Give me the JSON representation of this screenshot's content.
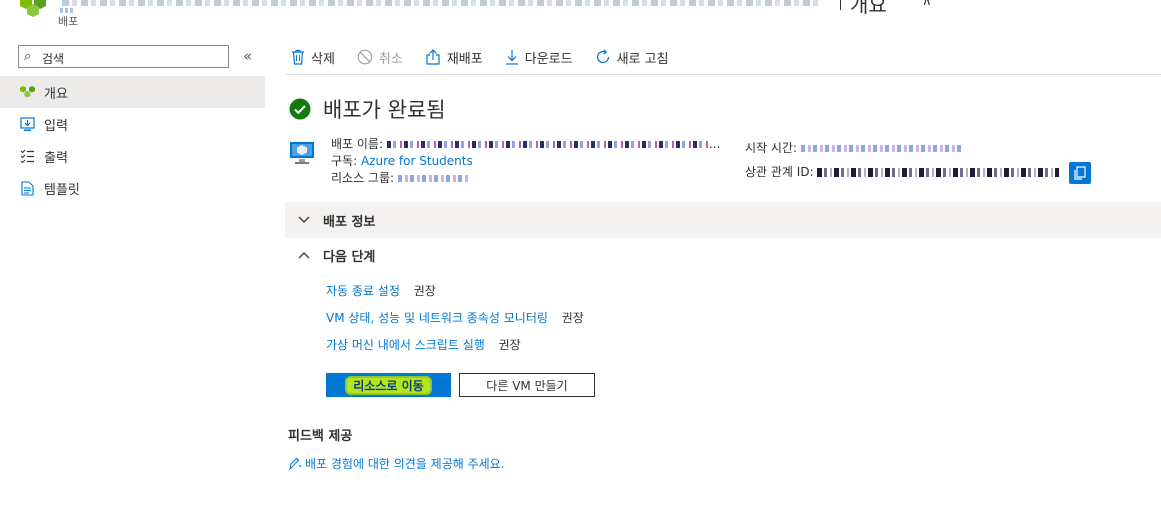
{
  "header": {
    "title_tail": "개요",
    "subtitle": "배포",
    "pin_glyph": "⊼"
  },
  "sidebar": {
    "search": {
      "placeholder": "검색"
    },
    "collapse_glyph": "«",
    "items": [
      {
        "label": "개요",
        "icon": "deployment-icon",
        "active": true
      },
      {
        "label": "입력",
        "icon": "inputs-icon",
        "active": false
      },
      {
        "label": "출력",
        "icon": "outputs-icon",
        "active": false
      },
      {
        "label": "템플릿",
        "icon": "template-icon",
        "active": false
      }
    ]
  },
  "toolbar": {
    "delete": "삭제",
    "cancel": "취소",
    "redeploy": "재배포",
    "download": "다운로드",
    "refresh": "새로 고침"
  },
  "status": {
    "title": "배포가 완료됨",
    "icon": "success-check-icon",
    "color": "#0f7b0f"
  },
  "details": {
    "name_label": "배포 이름:",
    "name_tail": "...",
    "subscription_label": "구독:",
    "subscription_value": "Azure for Students",
    "resource_group_label": "리소스 그룹:",
    "start_time_label": "시작 시간:",
    "correlation_label": "상관 관계 ID:"
  },
  "sections": {
    "deployment_details": "배포 정보",
    "next_steps": "다음 단계"
  },
  "next_steps": [
    {
      "link": "자동 종료 설정",
      "note": "권장"
    },
    {
      "link": "VM 상태, 성능 및 네트워크 종속성 모니터링",
      "note": "권장"
    },
    {
      "link": "가상 머신 내에서 스크립트 실행",
      "note": "권장"
    }
  ],
  "buttons": {
    "go_to_resource": "리소스로 이동",
    "create_another_vm": "다른 VM 만들기"
  },
  "feedback": {
    "title": "피드백 제공",
    "link": "배포 경험에 대한 의견을 제공해 주세요."
  },
  "colors": {
    "accent": "#0078d4",
    "highlight": "#b5e61d"
  }
}
